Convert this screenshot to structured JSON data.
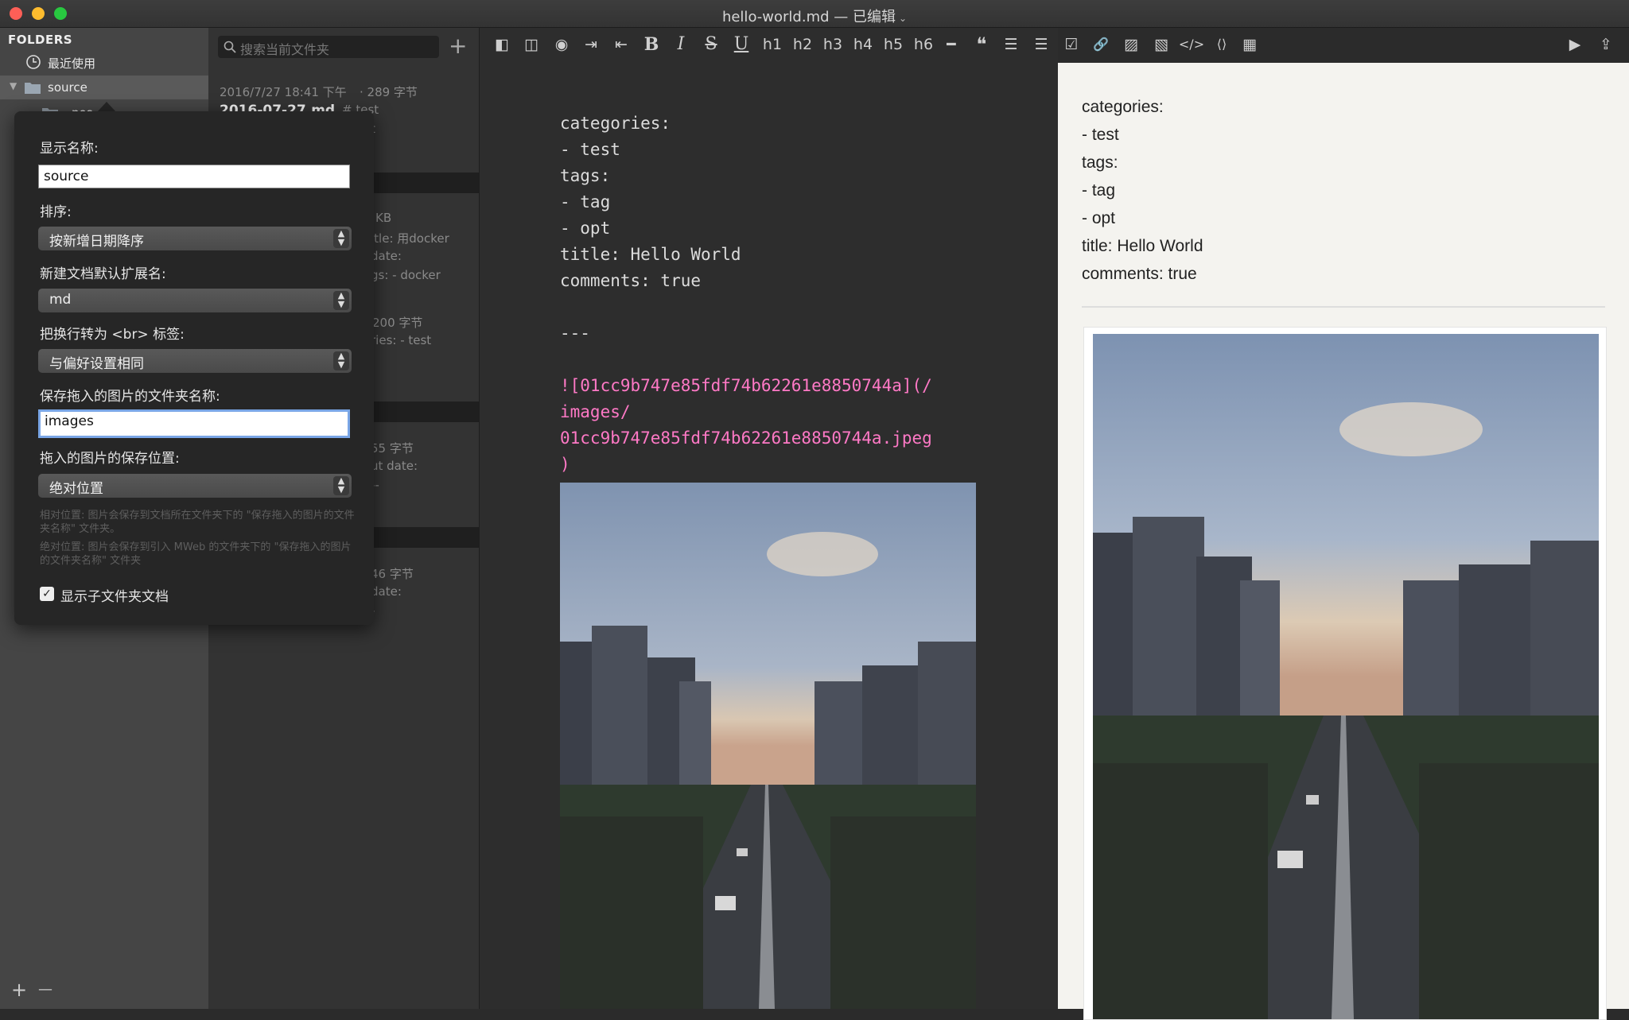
{
  "window": {
    "title": "hello-world.md — 已编辑",
    "title_chevron": "⌄"
  },
  "sidebar": {
    "header": "FOLDERS",
    "recent": "最近使用",
    "source": "source",
    "post_partial": "pos",
    "bottom_add": "+",
    "bottom_remove": "—"
  },
  "doclist": {
    "search_placeholder": "搜索当前文件夹",
    "add": "+",
    "entries": [
      {
        "meta": "2016/7/27 18:41 下午",
        "size": "· 289 字节",
        "title": "2016-07-27.md",
        "snippet": "# test"
      },
      {
        "fragment_1": "t",
        "fragment_2": "KB",
        "fragment_3": "itle: 用docker",
        "fragment_4": "date:",
        "fragment_5": "gs:  - docker"
      },
      {
        "size": "200 字节",
        "snippet": "ries: - test"
      },
      {
        "size": "55 字节",
        "snippet": "ut date:",
        "extra": "--"
      },
      {
        "size": "46 字节",
        "snippet": "date:",
        "extra": "-"
      }
    ]
  },
  "toolbar": {
    "buttons": [
      "◧",
      "◫",
      "◉",
      "⇥",
      "⇤",
      "B",
      "I",
      "S",
      "U",
      "h1",
      "h2",
      "h3",
      "h4",
      "h5",
      "h6",
      "━",
      "❝",
      "☰",
      "☰",
      "☑",
      "🔗",
      "▨",
      "▧",
      "</>",
      "⟨⟩",
      "▦"
    ],
    "right": [
      "▶",
      "⇪"
    ]
  },
  "editor": {
    "lines": [
      "categories:",
      "- test",
      "tags:",
      "- tag",
      "- opt",
      "title: Hello World",
      "comments: true",
      "",
      "---"
    ],
    "link_lines": [
      "![01cc9b747e85fdf74b62261e8850744a](/",
      "images/",
      "01cc9b747e85fdf74b62261e8850744a.jpeg",
      ")"
    ]
  },
  "preview": {
    "lines": [
      "categories:",
      "- test",
      "tags:",
      "- tag",
      "- opt",
      "title: Hello World",
      "comments: true"
    ]
  },
  "popover": {
    "display_name_label": "显示名称:",
    "display_name_value": "source",
    "sort_label": "排序:",
    "sort_value": "按新增日期降序",
    "ext_label": "新建文档默认扩展名:",
    "ext_value": "md",
    "br_label": "把换行转为 <br> 标签:",
    "br_value": "与偏好设置相同",
    "imgfolder_label": "保存拖入的图片的文件夹名称:",
    "imgfolder_value": "images",
    "imgpos_label": "拖入的图片的保存位置:",
    "imgpos_value": "绝对位置",
    "hint_1": "相对位置: 图片会保存到文档所在文件夹下的 \"保存拖入的图片的文件夹名称\" 文件夹。",
    "hint_2": "绝对位置: 图片会保存到引入 MWeb 的文件夹下的 \"保存拖入的图片的文件夹名称\" 文件夹",
    "show_sub_label": "显示子文件夹文档",
    "show_sub_checked": true
  },
  "colors": {
    "close": "#fe5f57",
    "minimize": "#febc2e",
    "zoom": "#28c840",
    "link": "#ff79c6",
    "preview_bg": "#f4f3ef"
  }
}
